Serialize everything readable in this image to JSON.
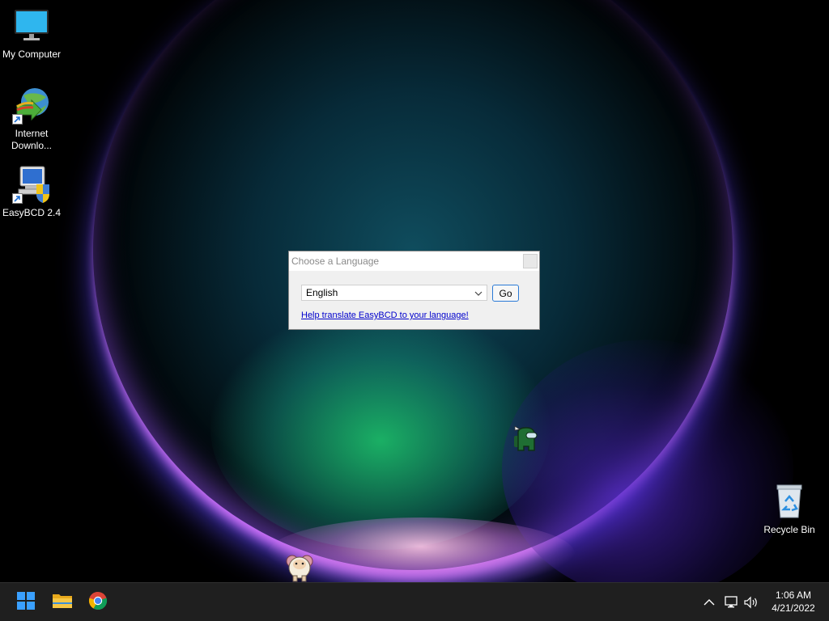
{
  "desktop": {
    "icons": [
      {
        "label": "My Computer",
        "icon": "monitor-icon"
      },
      {
        "label": "Internet Downlo...",
        "icon": "internet-download-manager-icon"
      },
      {
        "label": "EasyBCD 2.4",
        "icon": "easybcd-icon"
      },
      {
        "label": "Recycle Bin",
        "icon": "recycle-bin-icon"
      }
    ],
    "pets": [
      "among-us-crewmate-icon",
      "sheep-pet-icon"
    ]
  },
  "dialog": {
    "title": "Choose a Language",
    "language_selected": "English",
    "go_label": "Go",
    "help_link": "Help translate EasyBCD to your language!"
  },
  "taskbar": {
    "apps": [
      "start-icon",
      "file-explorer-icon",
      "chrome-icon"
    ],
    "tray_icons": [
      "chevron-up-icon",
      "network-icon",
      "volume-icon"
    ],
    "clock_time": "1:06 AM",
    "clock_date": "4/21/2022"
  },
  "colors": {
    "taskbar_bg": "#1f1f1f",
    "dialog_bg": "#f0f0f0",
    "link": "#0000cc",
    "go_border": "#2a7ad6"
  }
}
